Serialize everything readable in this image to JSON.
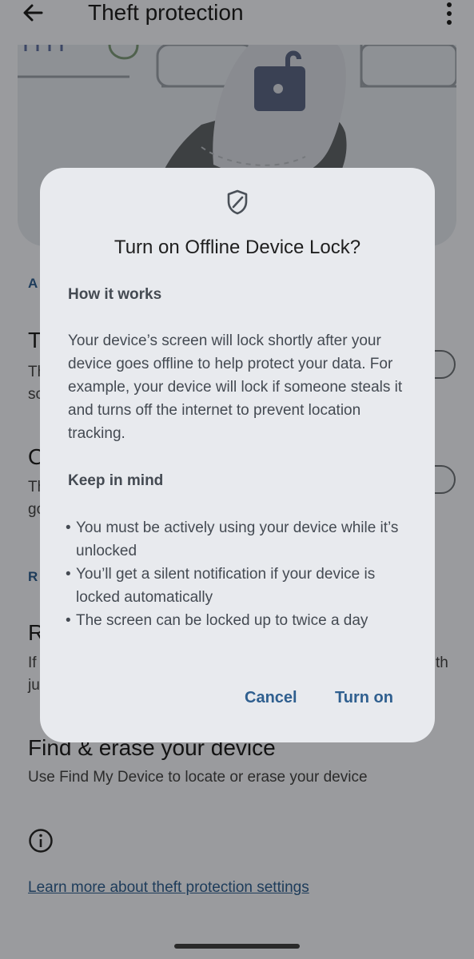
{
  "header": {
    "title": "Theft protection"
  },
  "background": {
    "section_1_initial": "A",
    "row_1": {
      "title_initial": "T",
      "sub_line_1": "Th",
      "sub_line_2": "sc"
    },
    "row_2": {
      "title_initial": "O",
      "sub_line_1": "Th",
      "sub_line_2": "go"
    },
    "section_2_initial": "R",
    "row_3": {
      "title_initial": "R",
      "sub_line_1": "If",
      "sub_line_1_end": "th",
      "sub_line_2": "ju"
    },
    "find_device": {
      "title": "Find & erase your device",
      "subtitle": "Use Find My Device to locate or erase your device"
    },
    "learn_more": "Learn more about theft protection settings"
  },
  "dialog": {
    "icon": "shield-icon",
    "title": "Turn on Offline Device Lock?",
    "how_heading": "How it works",
    "how_body": "Your device’s screen will lock shortly after your device goes offline to help protect your data. For example, your device will lock if someone steals it and turns off the internet to prevent location tracking.",
    "keep_heading": "Keep in mind",
    "bullets": [
      "You must be actively using your device while it’s unlocked",
      "You’ll get a silent notification if your device is locked automatically",
      "The screen can be locked up to twice a day"
    ],
    "cancel": "Cancel",
    "confirm": "Turn on"
  },
  "colors": {
    "accent": "#2f5f8f",
    "dialog_bg": "#e8eaee",
    "scrim": "rgba(0,0,0,0.36)"
  }
}
